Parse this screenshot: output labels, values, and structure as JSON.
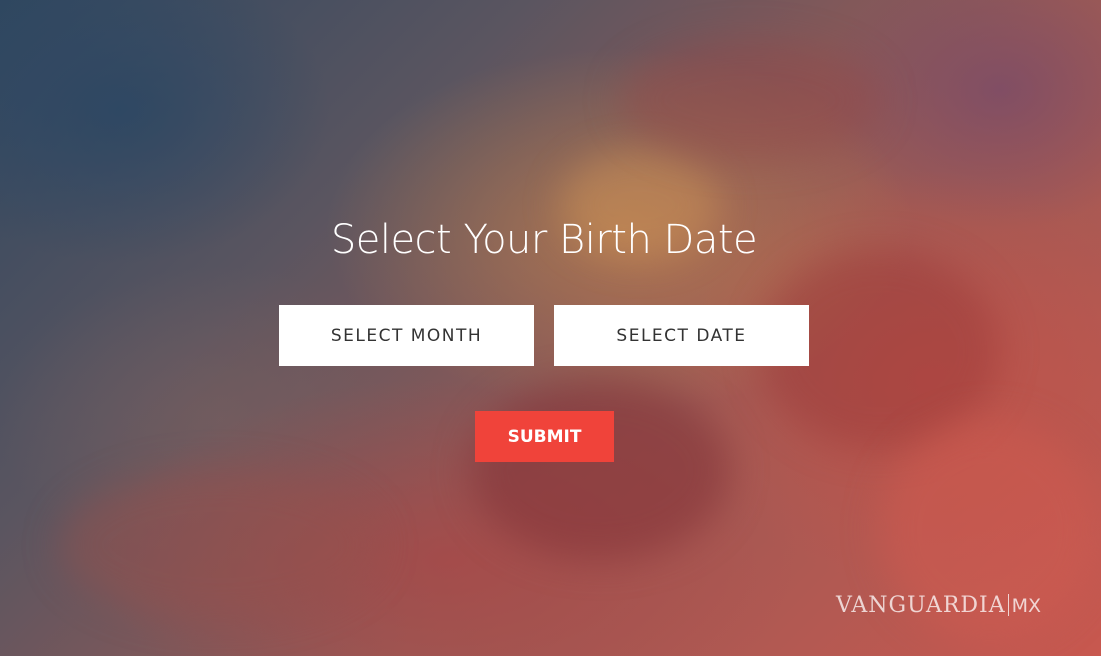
{
  "page": {
    "title": "Select Your Birth Date"
  },
  "controls": {
    "month_label": "SELECT MONTH",
    "date_label": "SELECT DATE",
    "submit_label": "SUBMIT"
  },
  "watermark": {
    "brand": "VANGUARDIA",
    "suffix": "MX"
  },
  "colors": {
    "submit_bg": "#f0433a",
    "select_bg": "#ffffff",
    "text_light": "#ffffff",
    "text_dark": "#333333"
  }
}
